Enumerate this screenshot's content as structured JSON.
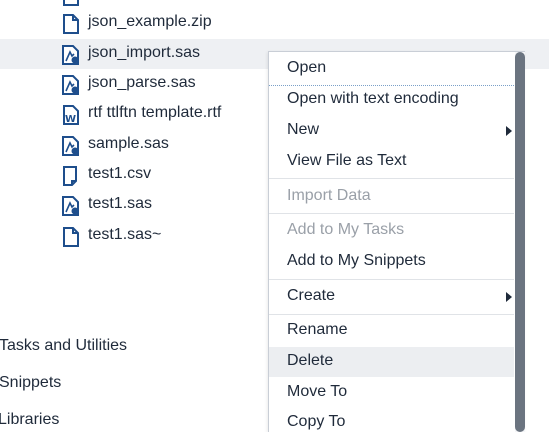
{
  "files": [
    {
      "name": "json_example.zip",
      "icon": "file-icon"
    },
    {
      "name": "json_import.sas",
      "icon": "sas-program-icon",
      "selected": true
    },
    {
      "name": "json_parse.sas",
      "icon": "sas-program-icon"
    },
    {
      "name": "rtf ttlftn template.rtf",
      "icon": "word-doc-icon"
    },
    {
      "name": "sample.sas",
      "icon": "sas-program-icon"
    },
    {
      "name": "test1.csv",
      "icon": "csv-file-icon"
    },
    {
      "name": "test1.sas",
      "icon": "sas-program-icon"
    },
    {
      "name": "test1.sas~",
      "icon": "file-icon"
    }
  ],
  "nav": {
    "tasks": "Tasks and Utilities",
    "snippets": "Snippets",
    "libraries": "Libraries"
  },
  "menu": {
    "open": "Open",
    "open_with_encoding": "Open with text encoding",
    "new": "New",
    "view_as_text": "View File as Text",
    "import_data": "Import Data",
    "add_to_tasks": "Add to My Tasks",
    "add_to_snippets": "Add to My Snippets",
    "create": "Create",
    "rename": "Rename",
    "delete": "Delete",
    "move_to": "Move To",
    "copy_to": "Copy To"
  },
  "colors": {
    "icon": "#1e4e8c",
    "selected_row": "#eef0f3",
    "hover_item": "#eceef1",
    "disabled_text": "#9aa0a8"
  }
}
